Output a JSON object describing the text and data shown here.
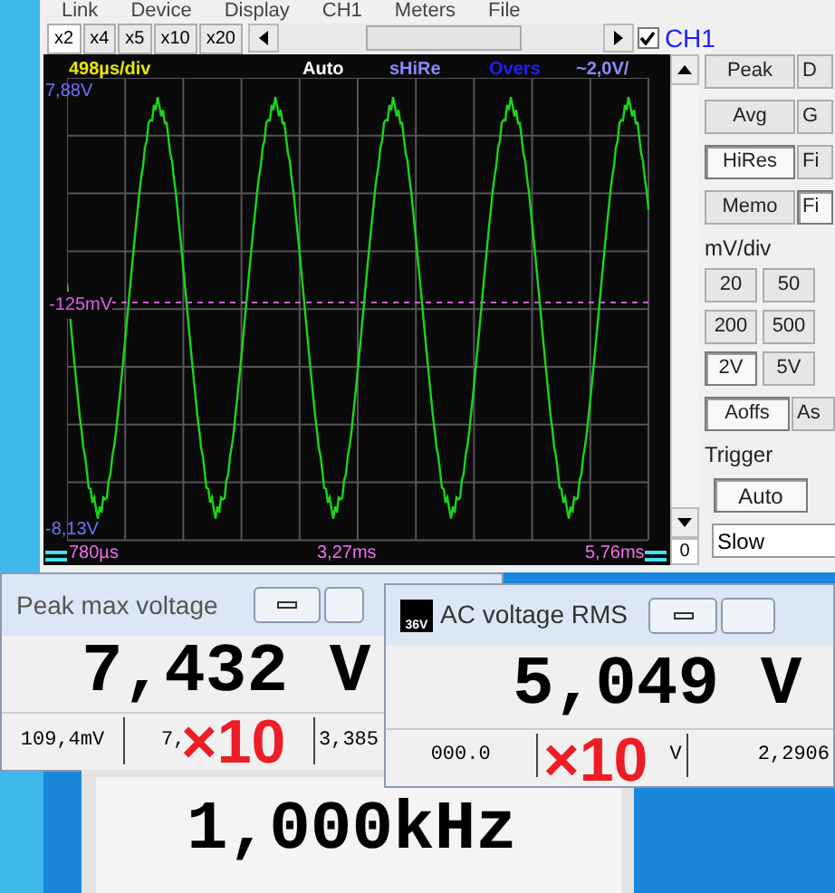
{
  "menu": [
    "Link",
    "Device",
    "Display",
    "CH1",
    "Meters",
    "File"
  ],
  "zoom_buttons": [
    {
      "label": "x2",
      "selected": true
    },
    {
      "label": "x4",
      "selected": false
    },
    {
      "label": "x5",
      "selected": false
    },
    {
      "label": "x10",
      "selected": false
    },
    {
      "label": "x20",
      "selected": false
    }
  ],
  "channel": {
    "label": "CH1",
    "checked": true
  },
  "scope": {
    "timebase": "498µs/div",
    "trigger_mode": "Auto",
    "acquisition": "sHiRe",
    "overs": "Overs",
    "range": "~2,0V/",
    "y_top": "7,88V",
    "y_marker": "-125mV",
    "y_bottom": "-8,13V",
    "x_left": "780µs",
    "x_center": "3,27ms",
    "x_right": "5,76ms"
  },
  "offset_reading": "0",
  "mode_buttons": [
    [
      {
        "label": "Peak",
        "selected": false
      },
      {
        "label": "D",
        "selected": false
      }
    ],
    [
      {
        "label": "Avg",
        "selected": false
      },
      {
        "label": "G",
        "selected": false
      }
    ],
    [
      {
        "label": "HiRes",
        "selected": true
      },
      {
        "label": "Fi",
        "selected": false
      }
    ],
    [
      {
        "label": "Memo",
        "selected": false
      },
      {
        "label": "Fi",
        "selected": true
      }
    ]
  ],
  "volts_div": {
    "title": "mV/div",
    "buttons": [
      [
        {
          "label": "20",
          "selected": false
        },
        {
          "label": "50",
          "selected": false
        }
      ],
      [
        {
          "label": "200",
          "selected": false
        },
        {
          "label": "500",
          "selected": false
        }
      ],
      [
        {
          "label": "2V",
          "selected": true
        },
        {
          "label": "5V",
          "selected": false
        }
      ]
    ]
  },
  "offset_buttons": [
    {
      "label": "Aoffs",
      "selected": true
    },
    {
      "label": "As",
      "selected": false
    }
  ],
  "trigger": {
    "title": "Trigger",
    "mode": {
      "label": "Auto",
      "selected": true
    },
    "speed": "Slow"
  },
  "peak_window": {
    "title": "Peak max voltage",
    "value": "7,432 V",
    "cells": [
      "109,4mV",
      "7,",
      "3,385"
    ]
  },
  "rms_window": {
    "title": "AC voltage RMS",
    "icon_label": "36V",
    "value": "5,049 V",
    "cells": [
      "000.0",
      "V",
      "2,2906"
    ]
  },
  "frequency_window": {
    "value": "1,000kHz"
  },
  "annotations": [
    "×10",
    "×10"
  ]
}
